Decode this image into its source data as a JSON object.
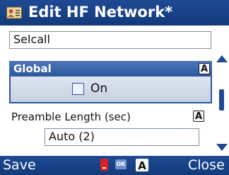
{
  "window": {
    "title": "Edit HF Network*"
  },
  "form": {
    "network_name": "Selcall",
    "global_row": {
      "label": "Global",
      "badge": "A"
    },
    "global_toggle": {
      "label": "On",
      "checked": false
    },
    "preamble": {
      "label": "Preamble Length (sec)",
      "badge": "A",
      "value": "Auto (2)"
    }
  },
  "softkeys": {
    "left": "Save",
    "right": "Close",
    "ok_label": "OK",
    "a_label": "A"
  },
  "icons": [
    "contact-card-icon",
    "keyboard-icon",
    "ok-icon",
    "alpha-mode-icon"
  ]
}
